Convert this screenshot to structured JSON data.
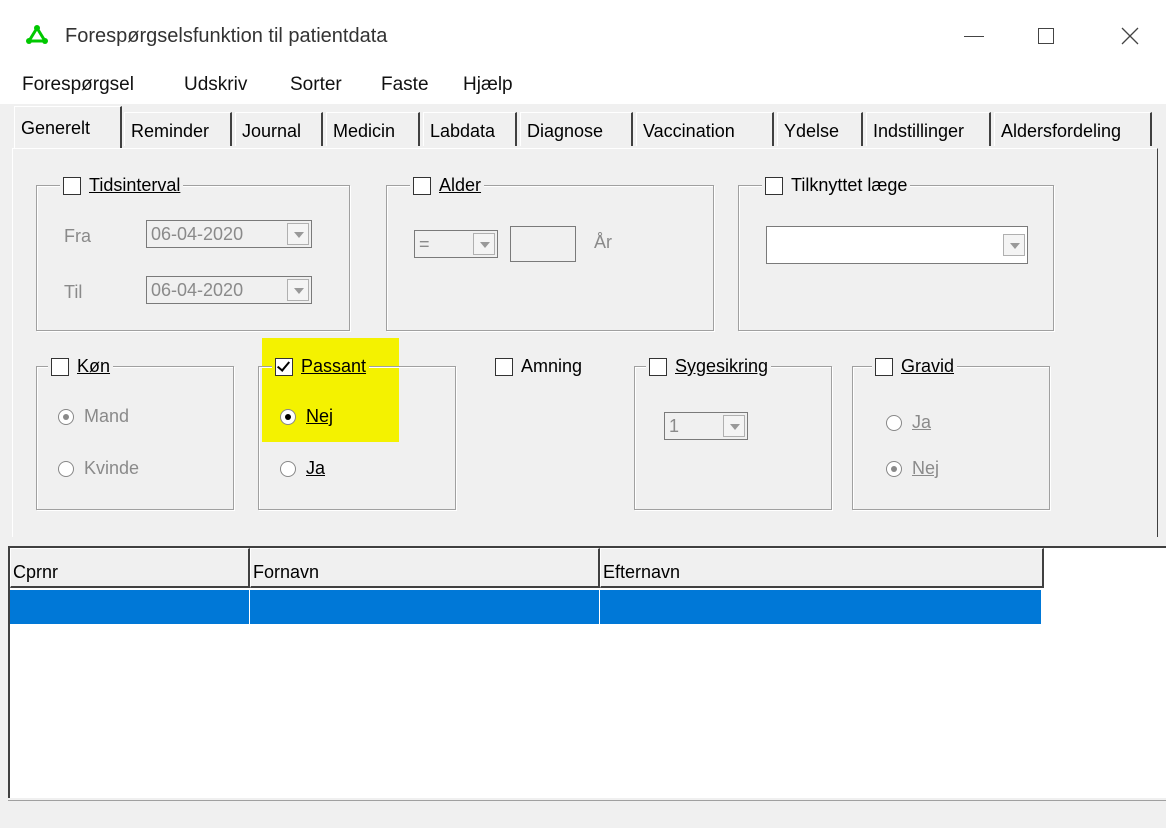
{
  "window": {
    "title": "Forespørgselsfunktion til patientdata",
    "app_icon": "green-triangle-icon",
    "controls": [
      "minimize-icon",
      "maximize-icon",
      "close-icon"
    ]
  },
  "menu": [
    "Forespørgsel",
    "Udskriv",
    "Sorter",
    "Faste",
    "Hjælp"
  ],
  "tabs": [
    "Generelt",
    "Reminder",
    "Journal",
    "Medicin",
    "Labdata",
    "Diagnose",
    "Vaccination",
    "Ydelse",
    "Indstillinger",
    "Aldersfordeling"
  ],
  "active_tab": "Generelt",
  "tidsinterval": {
    "label": "Tidsinterval",
    "checked": false,
    "fra_label": "Fra",
    "fra_value": "06-04-2020",
    "til_label": "Til",
    "til_value": "06-04-2020"
  },
  "alder": {
    "label": "Alder",
    "checked": false,
    "operator": "=",
    "value": "",
    "unit": "År"
  },
  "tilknyttet": {
    "label": "Tilknyttet læge",
    "checked": false,
    "value": ""
  },
  "koen": {
    "label": "Køn",
    "checked": false,
    "options": [
      "Mand",
      "Kvinde"
    ],
    "selected": "Mand"
  },
  "passant": {
    "label": "Passant",
    "checked": true,
    "options": [
      "Nej",
      "Ja"
    ],
    "selected": "Nej"
  },
  "amning": {
    "label": "Amning",
    "checked": false
  },
  "sygesikring": {
    "label": "Sygesikring",
    "checked": false,
    "value": "1"
  },
  "gravid": {
    "label": "Gravid",
    "checked": false,
    "options": [
      "Ja",
      "Nej"
    ],
    "selected": "Nej"
  },
  "table": {
    "columns": [
      "Cprnr",
      "Fornavn",
      "Efternavn"
    ],
    "rows": [
      [
        "",
        "",
        ""
      ]
    ],
    "selected_row": 0
  },
  "colors": {
    "highlight": "#f4f200",
    "selection": "#0078d7",
    "icon": "#00c800"
  }
}
